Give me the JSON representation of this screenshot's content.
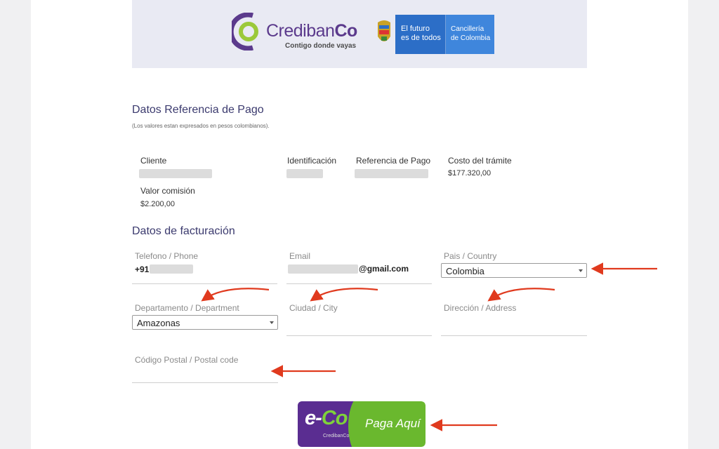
{
  "header": {
    "brand_name_light": "Crediban",
    "brand_name_bold": "Co",
    "brand_tagline": "Contigo donde vayas",
    "gov_line1": "El futuro",
    "gov_line2": "es de todos",
    "gov_right1": "Cancillería",
    "gov_right2": "de Colombia"
  },
  "payment_ref": {
    "title": "Datos Referencia de Pago",
    "note": "(Los valores estan expresados en pesos colombianos).",
    "cliente_label": "Cliente",
    "identificacion_label": "Identificación",
    "referencia_label": "Referencia de Pago",
    "costo_label": "Costo del trámite",
    "costo_value": "$177.320,00",
    "comision_label": "Valor comisión",
    "comision_value": "$2.200,00"
  },
  "billing": {
    "title": "Datos de facturación",
    "phone_label": "Telefono / Phone",
    "phone_prefix": "+91",
    "email_label": "Email",
    "email_suffix": "@gmail.com",
    "country_label": "Pais / Country",
    "country_value": "Colombia",
    "department_label": "Departamento / Department",
    "department_value": "Amazonas",
    "city_label": "Ciudad / City",
    "address_label": "Dirección / Address",
    "postal_label": "Código Postal / Postal code"
  },
  "pay_button": {
    "logo_e": "e-",
    "logo_co": "Co",
    "mini_brand": "CredibanCo",
    "label": "Paga Aquí"
  },
  "colors": {
    "brand_purple": "#5b3a8c",
    "gov_blue": "#2c6ec7",
    "arrow_red": "#e03a1e",
    "pay_green": "#6ab82e"
  }
}
